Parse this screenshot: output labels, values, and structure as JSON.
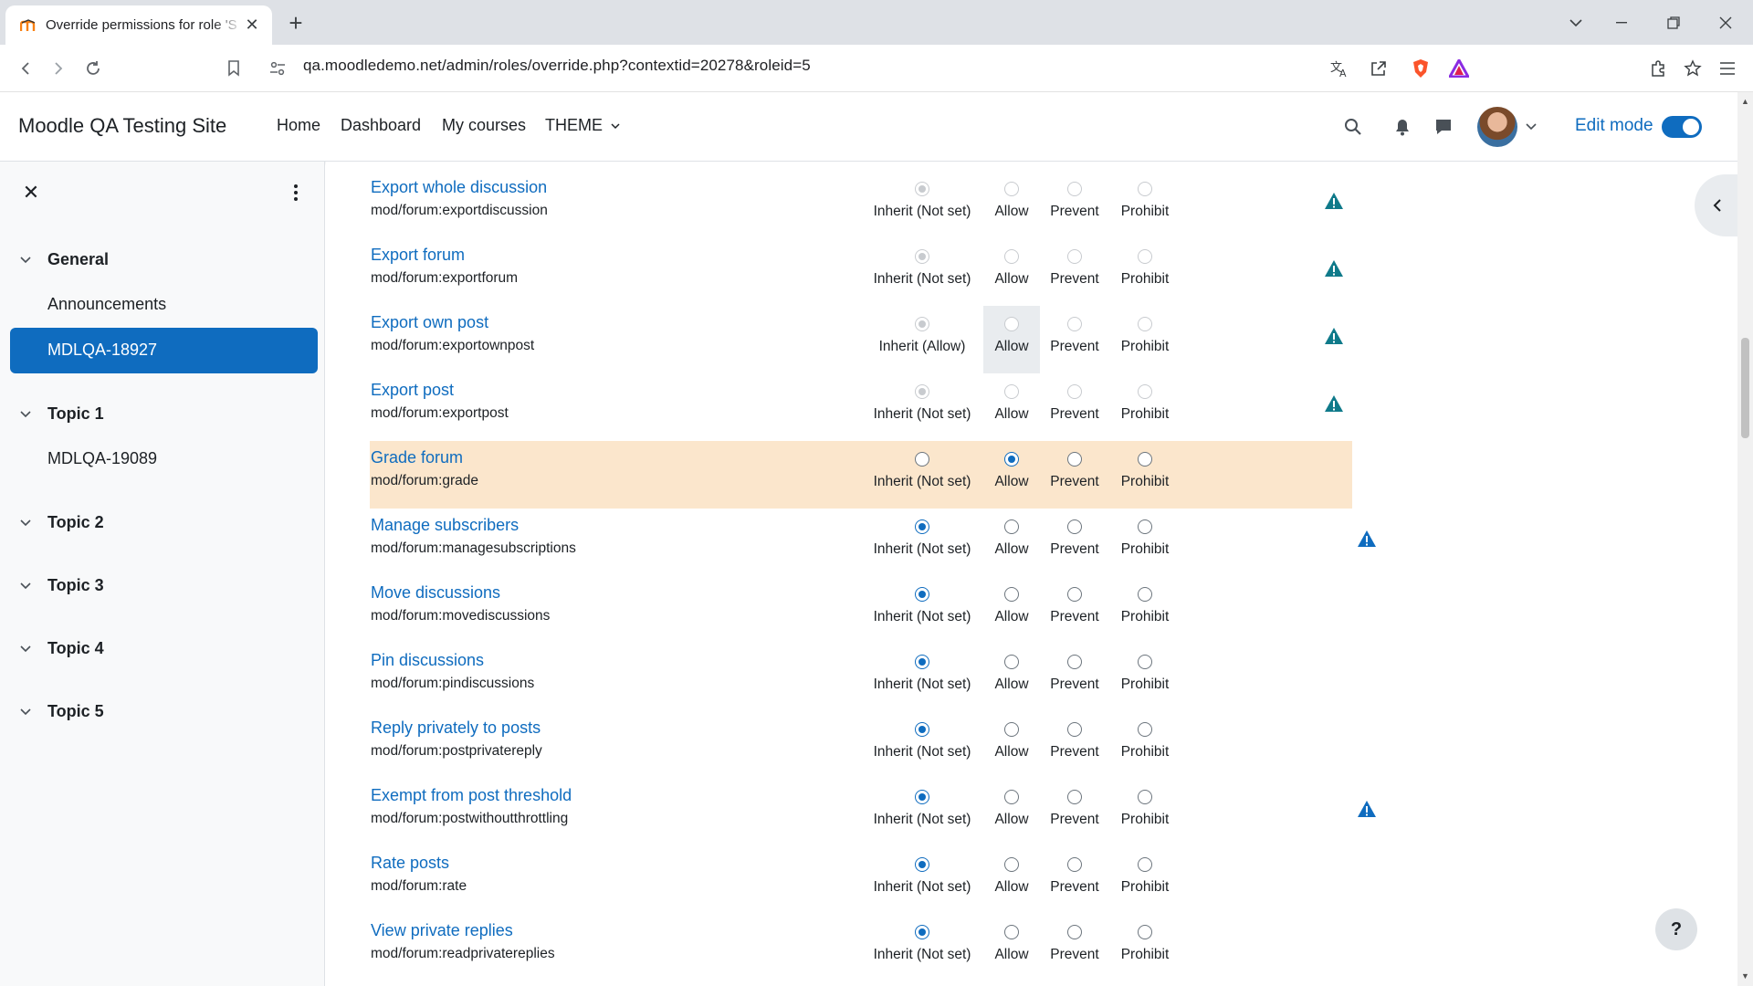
{
  "browser": {
    "tab_title": "Override permissions for role 'S",
    "url": "qa.moodledemo.net/admin/roles/override.php?contextid=20278&roleid=5"
  },
  "navbar": {
    "site_name": "Moodle QA Testing Site",
    "links": [
      "Home",
      "Dashboard",
      "My courses",
      "THEME"
    ],
    "edit_mode_label": "Edit mode",
    "edit_mode_on": true
  },
  "drawer": {
    "sections": [
      {
        "title": "General",
        "items": [
          "Announcements",
          "MDLQA-18927"
        ]
      },
      {
        "title": "Topic 1",
        "items": [
          "MDLQA-19089"
        ]
      },
      {
        "title": "Topic 2",
        "items": []
      },
      {
        "title": "Topic 3",
        "items": []
      },
      {
        "title": "Topic 4",
        "items": []
      },
      {
        "title": "Topic 5",
        "items": []
      }
    ],
    "active_item": "MDLQA-18927"
  },
  "option_labels": [
    "Allow",
    "Prevent",
    "Prohibit"
  ],
  "permissions": [
    {
      "name": "Export whole discussion",
      "capability": "mod/forum:exportdiscussion",
      "inherit_label": "Inherit (Not set)",
      "selected": "inherit",
      "disabled": true,
      "risk": true
    },
    {
      "name": "Export forum",
      "capability": "mod/forum:exportforum",
      "inherit_label": "Inherit (Not set)",
      "selected": "inherit",
      "disabled": true,
      "risk": true
    },
    {
      "name": "Export own post",
      "capability": "mod/forum:exportownpost",
      "inherit_label": "Inherit (Allow)",
      "selected": "inherit",
      "disabled": true,
      "risk": true
    },
    {
      "name": "Export post",
      "capability": "mod/forum:exportpost",
      "inherit_label": "Inherit (Not set)",
      "selected": "inherit",
      "disabled": true,
      "risk": true
    },
    {
      "name": "Grade forum",
      "capability": "mod/forum:grade",
      "inherit_label": "Inherit (Not set)",
      "selected": "allow",
      "disabled": false,
      "risk": false,
      "highlight": true
    },
    {
      "name": "Manage subscribers",
      "capability": "mod/forum:managesubscriptions",
      "inherit_label": "Inherit (Not set)",
      "selected": "inherit",
      "disabled": false,
      "risk": true
    },
    {
      "name": "Move discussions",
      "capability": "mod/forum:movediscussions",
      "inherit_label": "Inherit (Not set)",
      "selected": "inherit",
      "disabled": false,
      "risk": false
    },
    {
      "name": "Pin discussions",
      "capability": "mod/forum:pindiscussions",
      "inherit_label": "Inherit (Not set)",
      "selected": "inherit",
      "disabled": false,
      "risk": false
    },
    {
      "name": "Reply privately to posts",
      "capability": "mod/forum:postprivatereply",
      "inherit_label": "Inherit (Not set)",
      "selected": "inherit",
      "disabled": false,
      "risk": false
    },
    {
      "name": "Exempt from post threshold",
      "capability": "mod/forum:postwithoutthrottling",
      "inherit_label": "Inherit (Not set)",
      "selected": "inherit",
      "disabled": false,
      "risk": true
    },
    {
      "name": "Rate posts",
      "capability": "mod/forum:rate",
      "inherit_label": "Inherit (Not set)",
      "selected": "inherit",
      "disabled": false,
      "risk": false
    },
    {
      "name": "View private replies",
      "capability": "mod/forum:readprivatereplies",
      "inherit_label": "Inherit (Not set)",
      "selected": "inherit",
      "disabled": false,
      "risk": false
    }
  ],
  "help_label": "?",
  "colors": {
    "accent": "#0f6cbf",
    "highlight_row": "#fbe6cc",
    "risk_icon_teal": "#0f7a8a",
    "risk_icon_blue": "#0f6cbf"
  },
  "icons": [
    "back-icon",
    "forward-icon",
    "reload-icon",
    "bookmark-icon",
    "site-info-icon",
    "translate-icon",
    "share-icon",
    "brave-shield-icon",
    "brave-rewards-icon",
    "extensions-icon",
    "favorites-icon",
    "menu-icon",
    "search-icon",
    "bell-icon",
    "chat-icon",
    "warning-icon"
  ]
}
